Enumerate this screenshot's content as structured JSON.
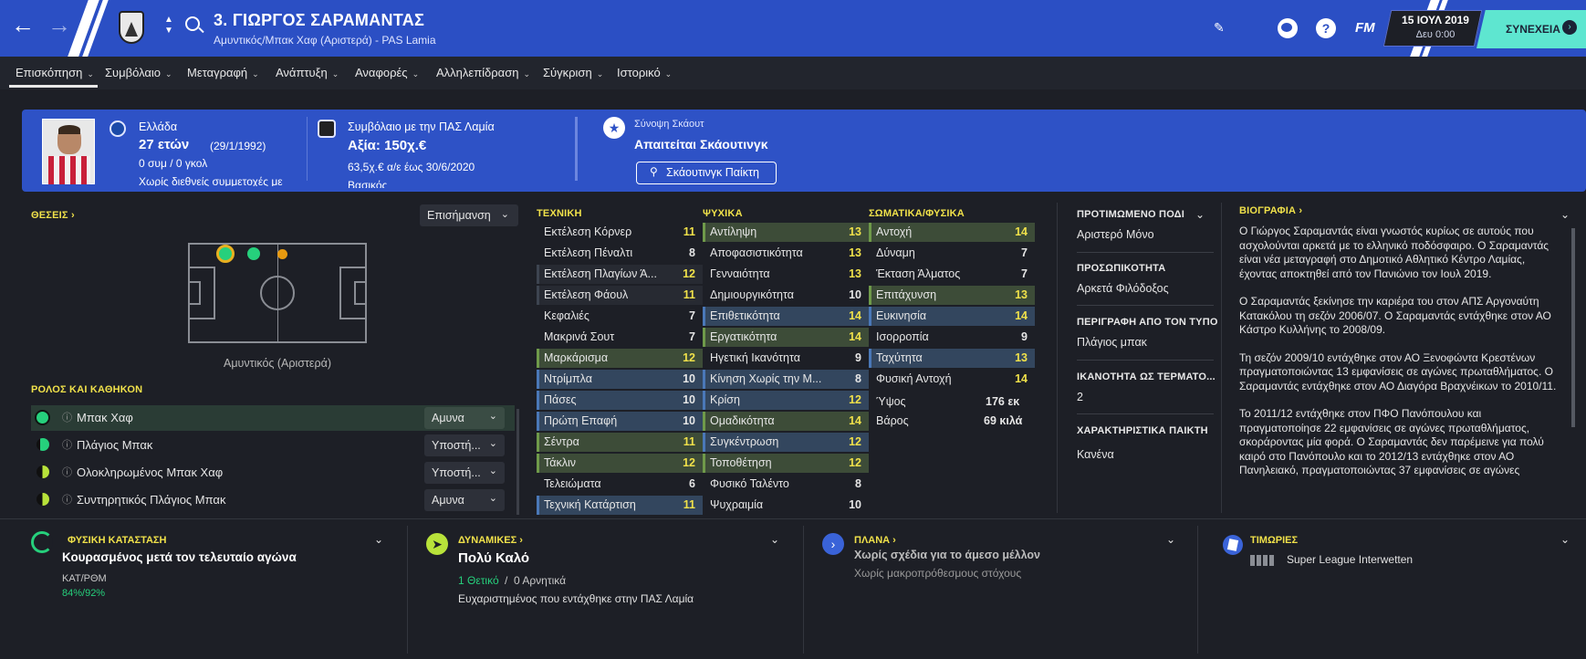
{
  "header": {
    "title": "3. ΓΙΩΡΓΟΣ ΣΑΡΑΜΑΝΤΑΣ",
    "subtitle": "Αμυντικός/Μπακ Χαφ (Αριστερά) - PAS Lamia",
    "fm_label": "FM",
    "date": "15 ΙΟΥΛ 2019",
    "time": "Δευ 0:00",
    "continue_label": "ΣΥΝΕΧΕΙΑ",
    "help": "?"
  },
  "tabs": [
    "Επισκόπηση",
    "Συμβόλαιο",
    "Μεταγραφή",
    "Ανάπτυξη",
    "Αναφορές",
    "Αλληλεπίδραση",
    "Σύγκριση",
    "Ιστορικό"
  ],
  "info": {
    "nation": "Ελλάδα",
    "age": "27 ετών",
    "dob": "(29/1/1992)",
    "caps": "0 συμ / 0 γκολ",
    "intl": "Χωρίς διεθνείς συμμετοχές με",
    "contract_title": "Συμβόλαιο με την ΠΑΣ Λαμία",
    "value": "Αξία: 150χ.€",
    "wage": "63,5χ.€ α/ε έως 30/6/2020",
    "contract_extra": "Βασικός",
    "scout_title": "Σύνοψη Σκάουτ",
    "scout_status": "Απαιτείται Σκάουτινγκ",
    "scout_button": "Σκάουτινγκ Παίκτη"
  },
  "positions": {
    "label": "ΘΕΣΕΙΣ",
    "highlight_dropdown": "Επισήμανση",
    "position_name": "Αμυντικός (Αριστερά)"
  },
  "roles": {
    "label": "ΡΟΛΟΣ ΚΑΙ ΚΑΘΗΚΟΝ",
    "items": [
      {
        "name": "Μπακ Χαφ",
        "duty": "Αμυνα"
      },
      {
        "name": "Πλάγιος Μπακ",
        "duty": "Υποστή..."
      },
      {
        "name": "Ολοκληρωμένος Μπακ Χαφ",
        "duty": "Υποστή..."
      },
      {
        "name": "Συντηρητικός Πλάγιος Μπακ",
        "duty": "Αμυνα"
      }
    ]
  },
  "technical": {
    "label": "ΤΕΧΝΙΚΗ",
    "items": [
      {
        "name": "Εκτέλεση Κόρνερ",
        "value": "11"
      },
      {
        "name": "Εκτέλεση Πέναλτι",
        "value": "8"
      },
      {
        "name": "Εκτέλεση Πλαγίων Ά...",
        "value": "12"
      },
      {
        "name": "Εκτέλεση Φάουλ",
        "value": "11"
      },
      {
        "name": "Κεφαλιές",
        "value": "7"
      },
      {
        "name": "Μακρινά Σουτ",
        "value": "7"
      },
      {
        "name": "Μαρκάρισμα",
        "value": "12"
      },
      {
        "name": "Ντρίμπλα",
        "value": "10"
      },
      {
        "name": "Πάσες",
        "value": "10"
      },
      {
        "name": "Πρώτη Επαφή",
        "value": "10"
      },
      {
        "name": "Σέντρα",
        "value": "11"
      },
      {
        "name": "Τάκλιν",
        "value": "12"
      },
      {
        "name": "Τελειώματα",
        "value": "6"
      },
      {
        "name": "Τεχνική Κατάρτιση",
        "value": "11"
      }
    ]
  },
  "mental": {
    "label": "ΨΥΧΙΚΑ",
    "items": [
      {
        "name": "Αντίληψη",
        "value": "13"
      },
      {
        "name": "Αποφασιστικότητα",
        "value": "13"
      },
      {
        "name": "Γενναιότητα",
        "value": "13"
      },
      {
        "name": "Δημιουργικότητα",
        "value": "10"
      },
      {
        "name": "Επιθετικότητα",
        "value": "14"
      },
      {
        "name": "Εργατικότητα",
        "value": "14"
      },
      {
        "name": "Ηγετική Ικανότητα",
        "value": "9"
      },
      {
        "name": "Κίνηση Χωρίς την Μ...",
        "value": "8"
      },
      {
        "name": "Κρίση",
        "value": "12"
      },
      {
        "name": "Ομαδικότητα",
        "value": "14"
      },
      {
        "name": "Συγκέντρωση",
        "value": "12"
      },
      {
        "name": "Τοποθέτηση",
        "value": "12"
      },
      {
        "name": "Φυσικό Ταλέντο",
        "value": "8"
      },
      {
        "name": "Ψυχραιμία",
        "value": "10"
      }
    ]
  },
  "physical": {
    "label": "ΣΩΜΑΤΙΚΑ/ΦΥΣΙΚΑ",
    "items": [
      {
        "name": "Αντοχή",
        "value": "14"
      },
      {
        "name": "Δύναμη",
        "value": "7"
      },
      {
        "name": "Έκταση Άλματος",
        "value": "7"
      },
      {
        "name": "Επιτάχυνση",
        "value": "13"
      },
      {
        "name": "Ευκινησία",
        "value": "14"
      },
      {
        "name": "Ισορροπία",
        "value": "9"
      },
      {
        "name": "Ταχύτητα",
        "value": "13"
      },
      {
        "name": "Φυσική Αντοχή",
        "value": "14"
      }
    ],
    "height_label": "Ύψος",
    "height": "176 εκ",
    "weight_label": "Βάρος",
    "weight": "69 κιλά"
  },
  "side": {
    "foot_label": "ΠΡΟΤΙΜΩΜΕΝΟ ΠΟΔΙ",
    "foot": "Αριστερό Μόνο",
    "personality_label": "ΠΡΟΣΩΠΙΚΟΤΗΤΑ",
    "personality": "Αρκετά Φιλόδοξος",
    "media_label": "ΠΕΡΙΓΡΑΦΗ ΑΠΟ ΤΟΝ ΤΥΠΟ",
    "media": "Πλάγιος μπακ",
    "gk_label": "ΙΚΑΝΟΤΗΤΑ ΩΣ ΤΕΡΜΑΤΟ...",
    "gk": "2",
    "traits_label": "ΧΑΡΑΚΤΗΡΙΣΤΙΚΑ ΠΑΙΚΤΗ",
    "traits": "Κανένα"
  },
  "bio": {
    "label": "ΒΙΟΓΡΑΦΙΑ",
    "p1": "Ο Γιώργος Σαραμαντάς είναι γνωστός κυρίως σε αυτούς που ασχολούνται αρκετά με το ελληνικό ποδόσφαιρο. Ο Σαραμαντάς είναι νέα μεταγραφή στο Δημοτικό Αθλητικό Κέντρο Λαμίας, έχοντας αποκτηθεί από τον Πανιώνιο τον Ιουλ 2019.",
    "p2": "Ο Σαραμαντάς ξεκίνησε την καριέρα του στον ΑΠΣ Αργοναύτη Κατακόλου τη σεζόν 2006/07. Ο Σαραμαντάς εντάχθηκε στον ΑΟ Κάστρο Κυλλήνης το 2008/09.",
    "p3": "Τη σεζόν 2009/10 εντάχθηκε στον ΑΟ Ξενοφώντα Κρεστένων πραγματοποιώντας 13 εμφανίσεις σε αγώνες πρωταθλήματος. Ο Σαραμαντάς εντάχθηκε στον ΑΟ Διαγόρα Βραχνέικων το 2010/11.",
    "p4": "Το 2011/12 εντάχθηκε στον ΠΦΟ Πανόπουλου και πραγματοποίησε 22 εμφανίσεις σε αγώνες πρωταθλήματος, σκοράροντας μία φορά. Ο Σαραμαντάς δεν παρέμεινε για πολύ καιρό στο Πανόπουλο και το 2012/13 εντάχθηκε στον ΑΟ Πανηλειακό, πραγματοποιώντας 37 εμφανίσεις σε αγώνες"
  },
  "cards": {
    "condition": {
      "title": "ΦΥΣΙΚΗ ΚΑΤΑΣΤΑΣΗ",
      "main": "Κουρασμένος μετά τον τελευταίο αγώνα",
      "sub_label": "ΚΑΤ/ΡΘΜ",
      "sub_value": "84%/92%"
    },
    "dynamics": {
      "title": "ΔΥΝΑΜΙΚΕΣ",
      "main": "Πολύ Καλό",
      "positive": "1 Θετικό",
      "slash": "/",
      "negative": "0 Αρνητικά",
      "note": "Ευχαριστημένος που εντάχθηκε στην ΠΑΣ Λαμία"
    },
    "plans": {
      "title": "ΠΛΑΝΑ",
      "main": "Χωρίς σχέδια για το άμεσο μέλλον",
      "sub": "Χωρίς μακροπρόθεσμους στόχους"
    },
    "penalties": {
      "title": "ΤΙΜΩΡΙΕΣ",
      "league": "Super League Interwetten"
    }
  },
  "colors": {
    "accent": "#2b4fc4",
    "highlight": "#f0e14a",
    "continue": "#5ee6d0",
    "good": "#26d07c"
  }
}
